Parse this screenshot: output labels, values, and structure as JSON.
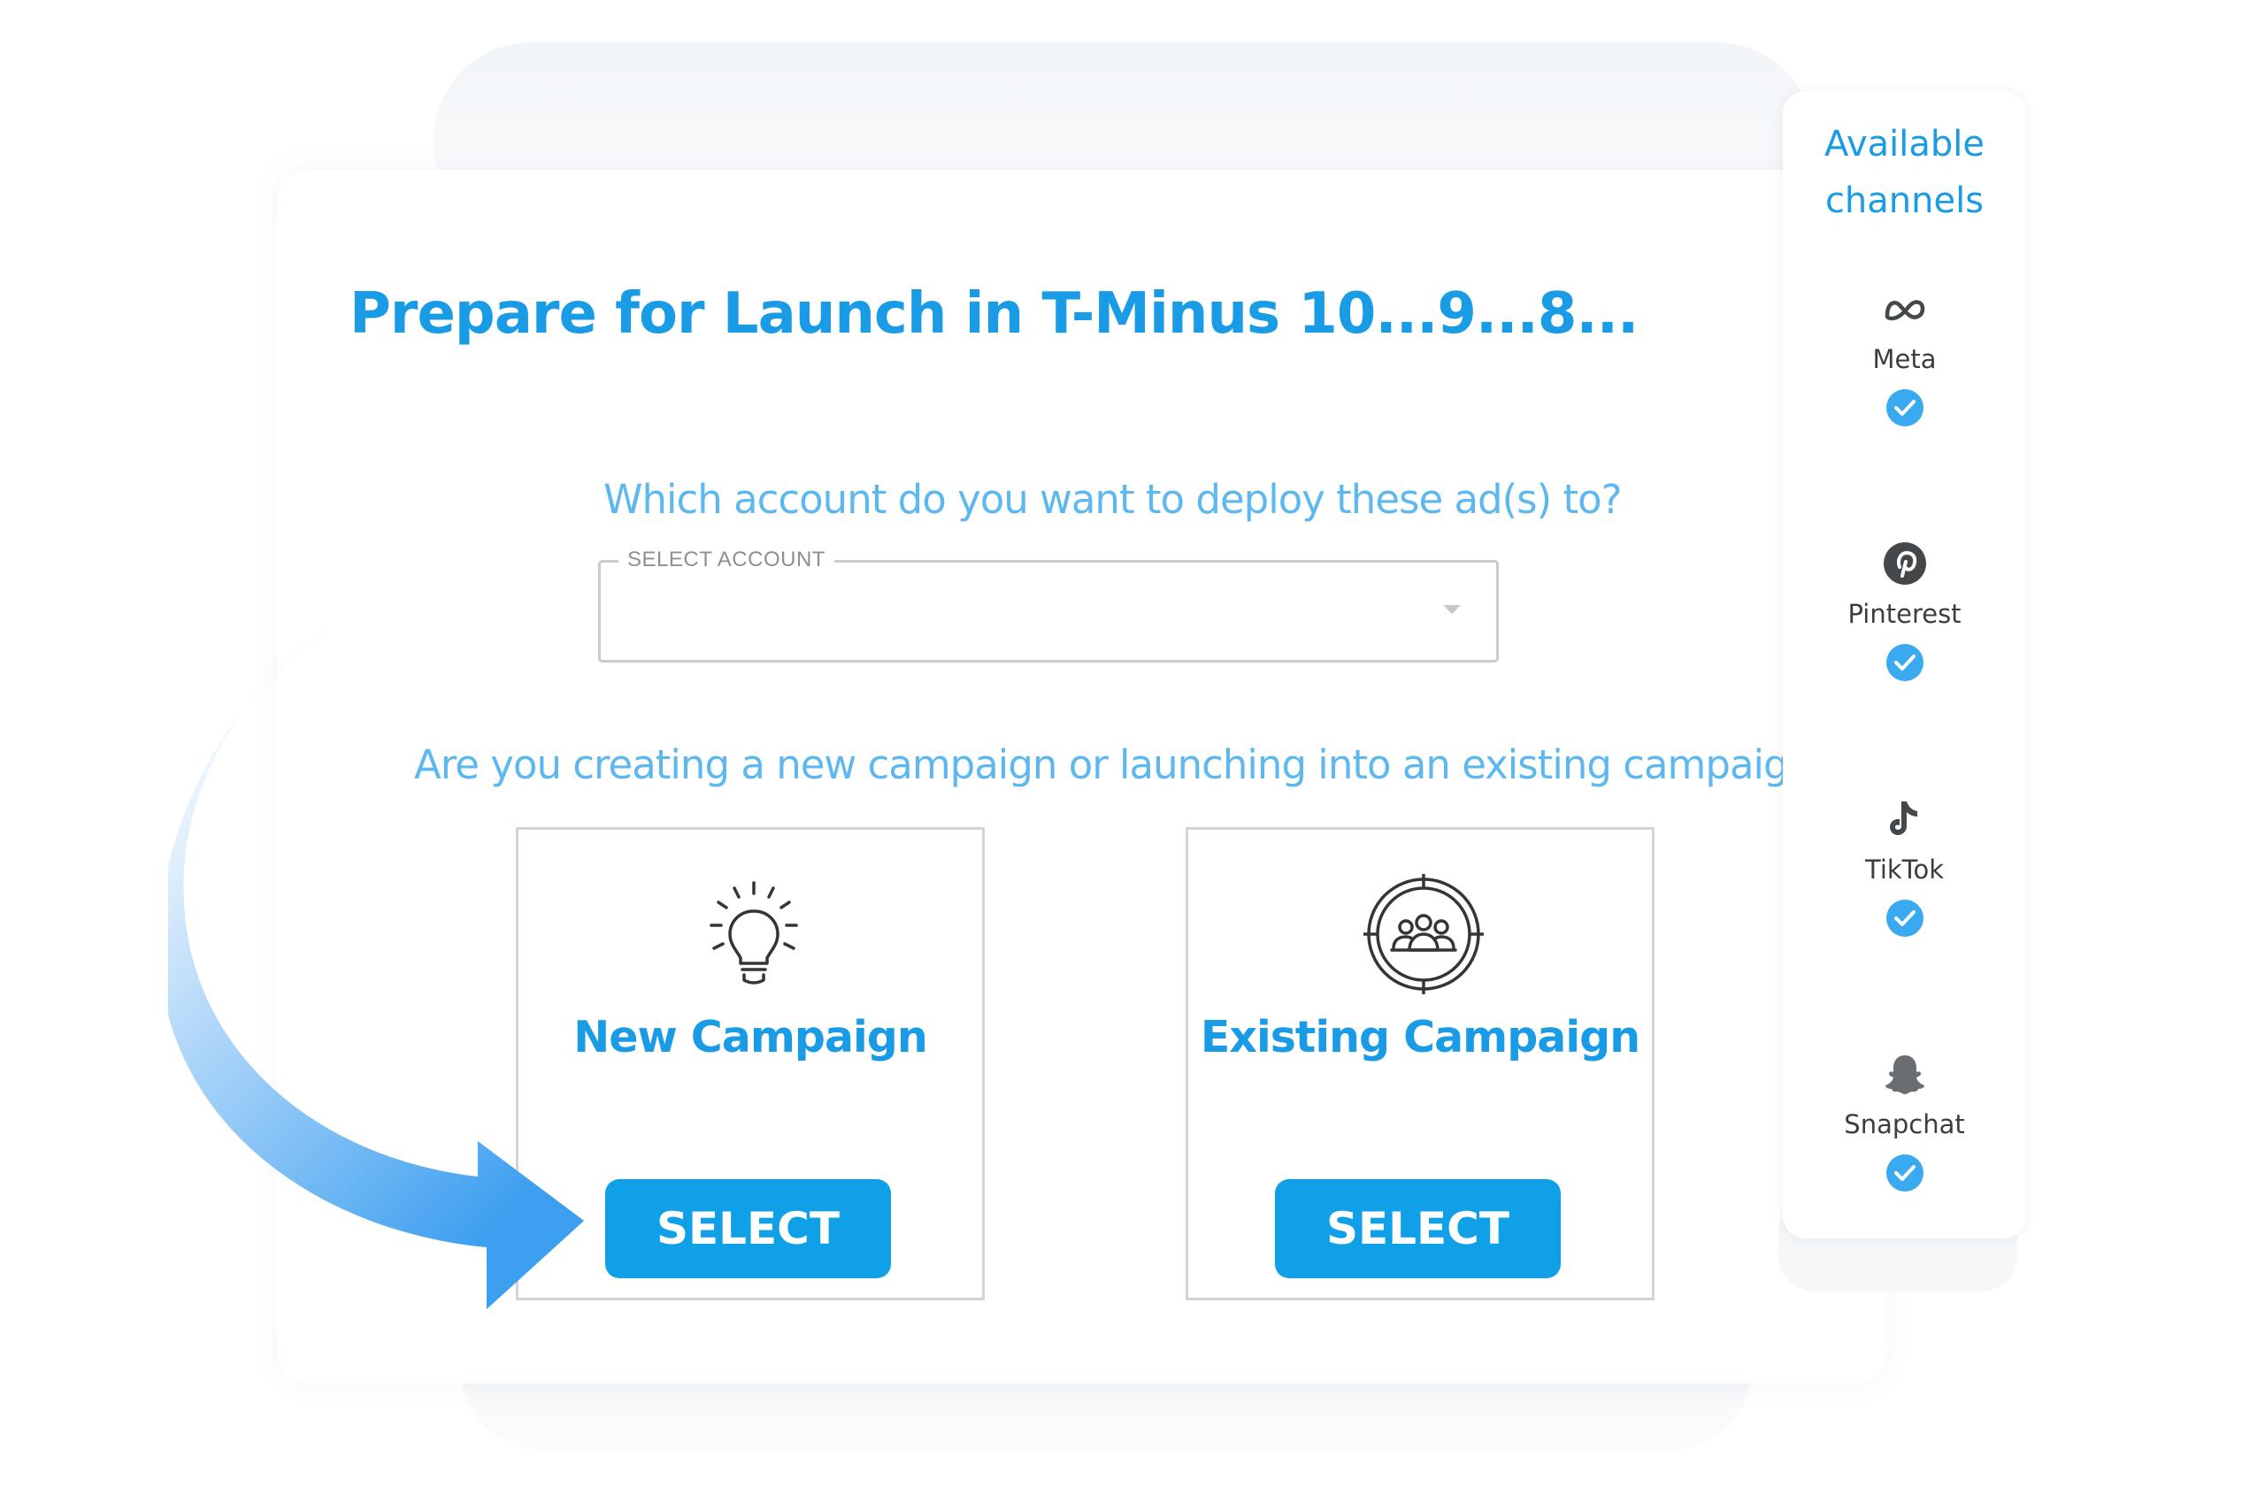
{
  "page": {
    "title": "Prepare for Launch in T-Minus 10...9...8...",
    "account_question": "Which account do you want to deploy these ad(s) to?",
    "campaign_question": "Are you creating a new campaign or launching into an existing campaign?"
  },
  "account_select": {
    "label": "SELECT ACCOUNT",
    "value": ""
  },
  "options": [
    {
      "title": "New Campaign",
      "button": "SELECT",
      "icon": "lightbulb-icon"
    },
    {
      "title": "Existing Campaign",
      "button": "SELECT",
      "icon": "audience-target-icon"
    }
  ],
  "channels": {
    "title": "Available\nchannels",
    "items": [
      {
        "label": "Meta",
        "icon": "meta-icon",
        "checked": true
      },
      {
        "label": "Pinterest",
        "icon": "pinterest-icon",
        "checked": true
      },
      {
        "label": "TikTok",
        "icon": "tiktok-icon",
        "checked": true
      },
      {
        "label": "Snapchat",
        "icon": "snapchat-icon",
        "checked": true
      }
    ]
  },
  "colors": {
    "accent": "#1a9be5",
    "button": "#0fa0e8",
    "question": "#5cb8ef",
    "check": "#3aaaf0"
  }
}
